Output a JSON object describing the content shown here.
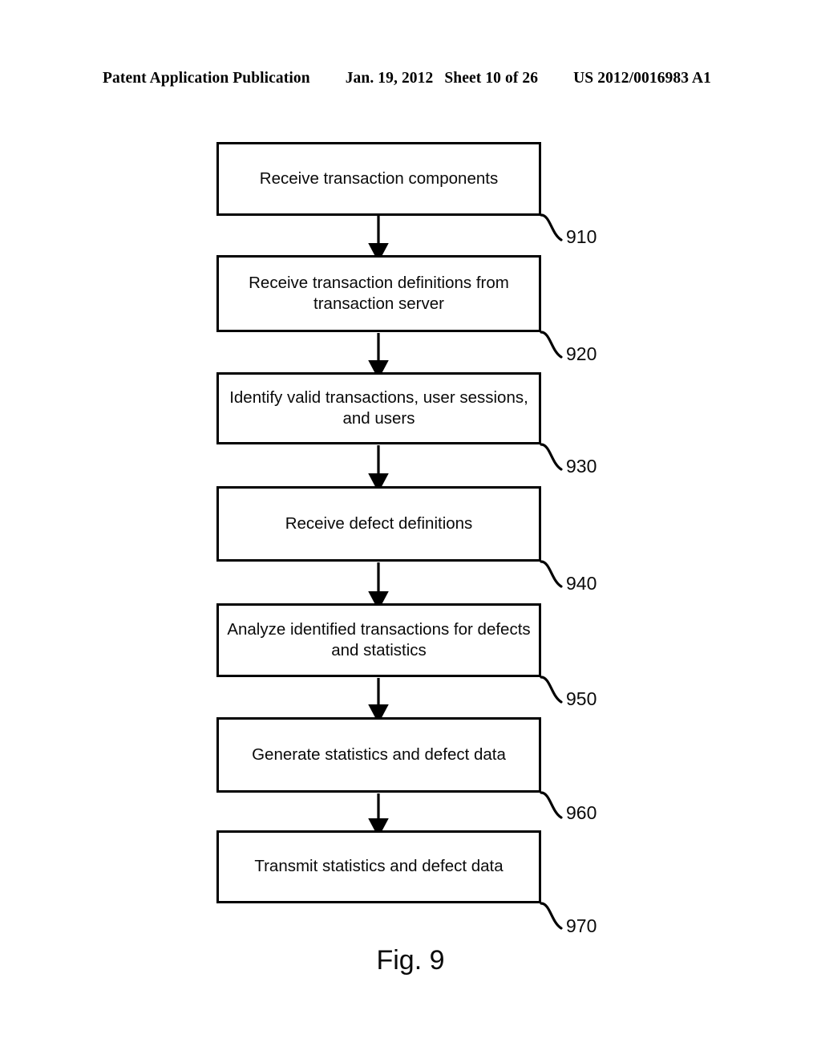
{
  "header": {
    "publication": "Patent Application Publication",
    "date": "Jan. 19, 2012",
    "sheet": "Sheet 10 of 26",
    "patent_number": "US 2012/0016983 A1"
  },
  "figure": {
    "caption": "Fig. 9",
    "steps": [
      {
        "id": "910",
        "label": "Receive transaction components"
      },
      {
        "id": "920",
        "label": "Receive transaction definitions from transaction server"
      },
      {
        "id": "930",
        "label": "Identify valid transactions, user sessions, and users"
      },
      {
        "id": "940",
        "label": "Receive defect definitions"
      },
      {
        "id": "950",
        "label": "Analyze identified transactions for defects and statistics"
      },
      {
        "id": "960",
        "label": "Generate statistics and defect data"
      },
      {
        "id": "970",
        "label": "Transmit statistics and defect data"
      }
    ]
  },
  "colors": {
    "ink": "#000000",
    "paper": "#ffffff"
  }
}
